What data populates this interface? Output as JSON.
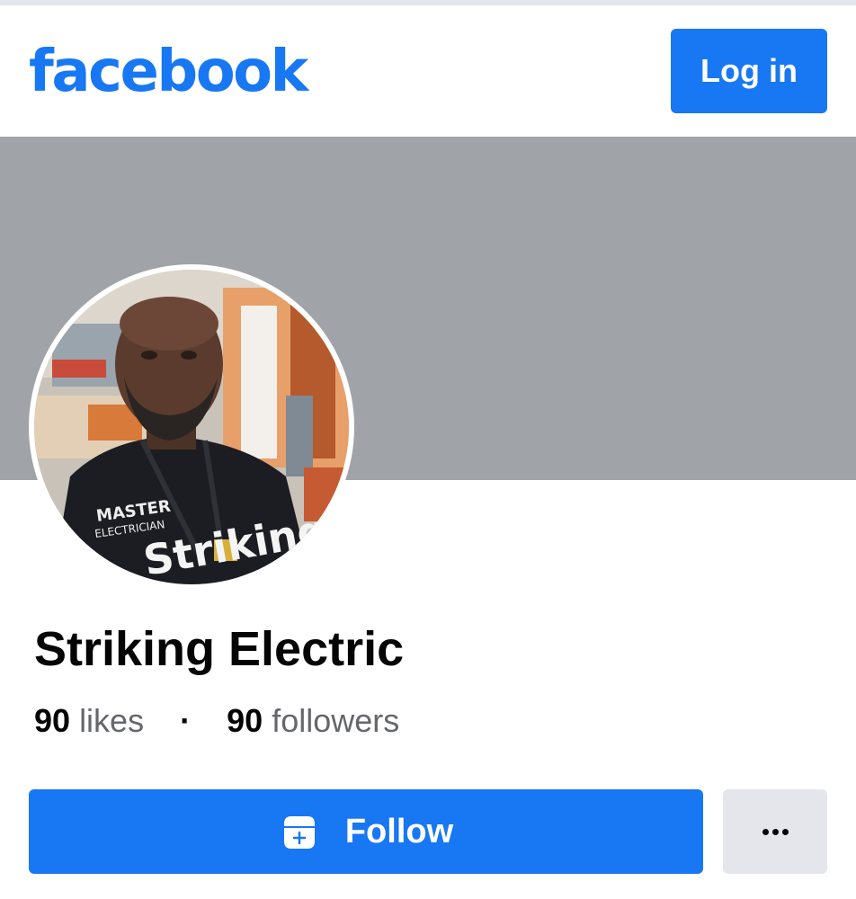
{
  "header": {
    "logo_text": "facebook",
    "login_label": "Log in",
    "brand_color": "#1877f2"
  },
  "cover": {
    "color": "#a0a3a8"
  },
  "profile": {
    "avatar_alt": "profile-photo",
    "name": "Striking Electric",
    "likes_count": "90",
    "likes_label": "likes",
    "separator": "·",
    "followers_count": "90",
    "followers_label": "followers"
  },
  "actions": {
    "follow_label": "Follow",
    "follow_icon": "follow-icon",
    "more_icon": "more-icon"
  }
}
